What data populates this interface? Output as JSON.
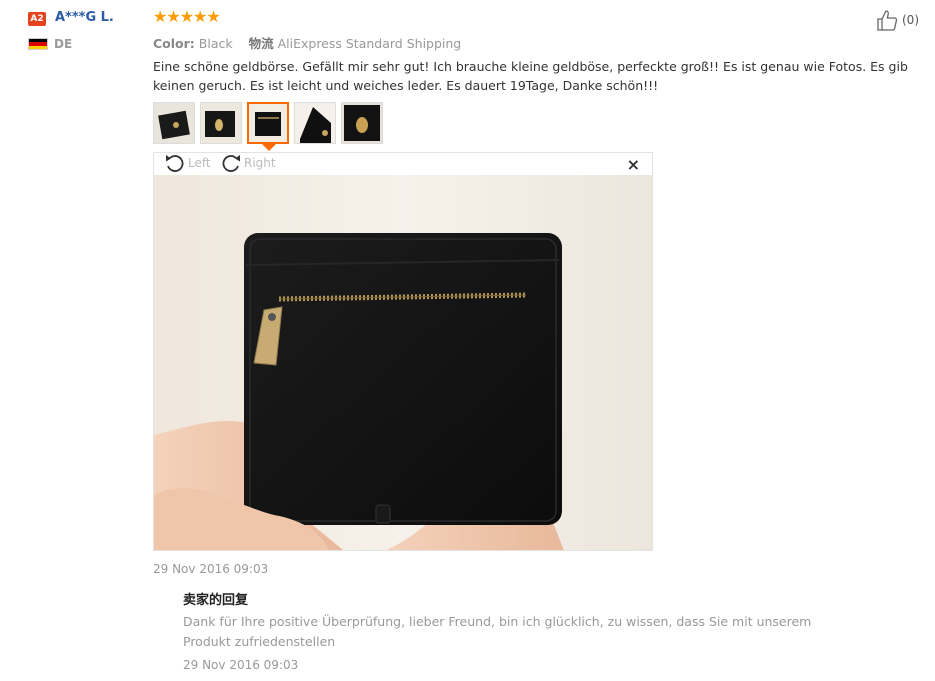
{
  "user": {
    "level_badge": "A2",
    "name": "A***G L.",
    "country": "DE",
    "flag_colors": [
      "#000000",
      "#dd0000",
      "#ffce00"
    ]
  },
  "review": {
    "stars": "★★★★★",
    "rating": 5,
    "color_label": "Color:",
    "color_value": "Black",
    "shipping_label_cn": "物流",
    "shipping_value": "AliExpress Standard Shipping",
    "text": "Eine schöne geldbörse. Gefällt mir sehr gut! Ich brauche kleine geldböse, perfeckte groß!! Es ist genau wie Fotos. Es gib keinen geruch. Es ist leicht und weiches leder. Es dauert 19Tage, Danke schön!!!",
    "date": "29 Nov 2016 09:03",
    "helpful_count": "(0)",
    "thumbnails_count": 5,
    "active_thumbnail": 3
  },
  "viewer": {
    "rotate_left_label": "Left",
    "rotate_right_label": "Right",
    "close_label": "×"
  },
  "seller_reply": {
    "title": "卖家的回复",
    "text": "Dank für Ihre positive Überprüfung, lieber Freund, bin ich glücklich, zu wissen, dass Sie mit unserem Produkt zufriedenstellen",
    "date": "29 Nov 2016 09:03"
  },
  "colors": {
    "accent_orange": "#ff6a00",
    "star_color": "#ff9a00",
    "username_blue": "#2d5ba6",
    "badge_red": "#e4431e"
  }
}
